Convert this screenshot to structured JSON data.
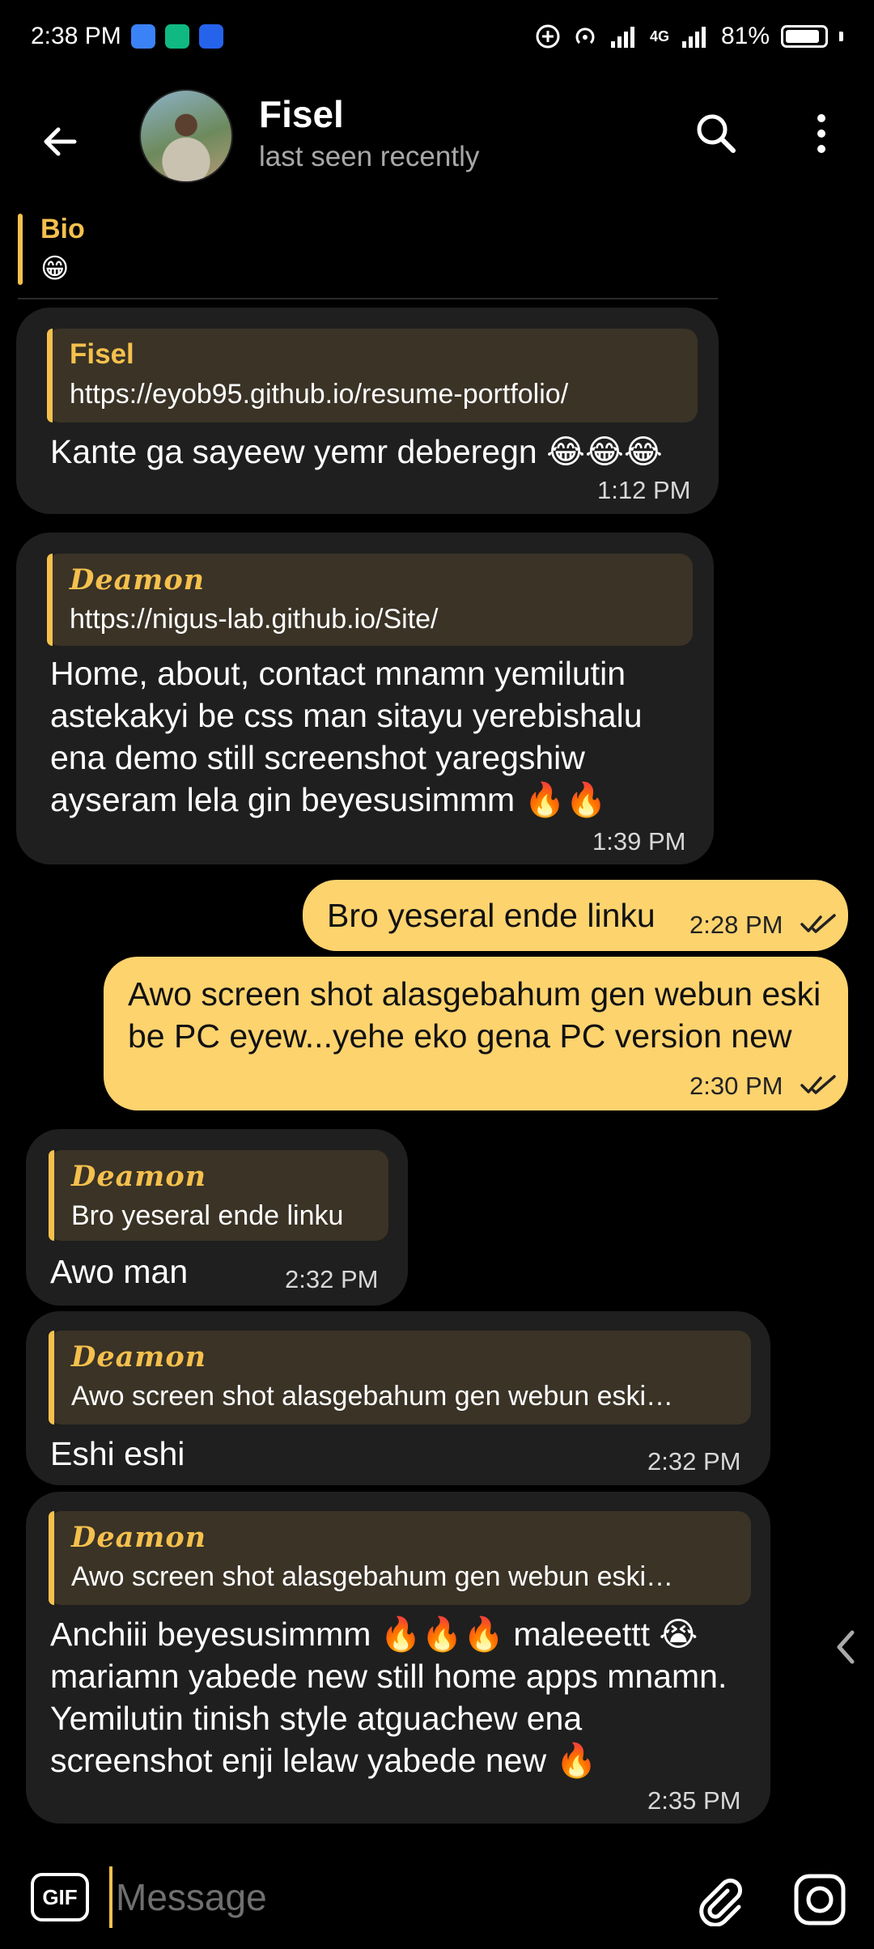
{
  "status_bar": {
    "time": "2:38 PM",
    "network": "4G",
    "battery": "81%",
    "app_icon_colors": [
      "#3b82f6",
      "#10b981",
      "#2563eb"
    ]
  },
  "header": {
    "contact_name": "Fisel",
    "status": "last seen recently",
    "icons": [
      "back-arrow-icon",
      "search-icon",
      "more-vert-icon"
    ]
  },
  "bio": {
    "label": "Bio",
    "emoji": "😁"
  },
  "messages": [
    {
      "direction": "in",
      "reply_name": "Fisel",
      "reply_text": "https://eyob95.github.io/resume-portfolio/",
      "text": "Kante ga sayeew yemr deberegn 😂😂😂",
      "time": "1:12 PM"
    },
    {
      "direction": "in",
      "reply_name": "Deamon",
      "reply_text": "https://nigus-lab.github.io/Site/",
      "text": "Home, about, contact mnamn yemilutin astekakyi be css man sitayu yerebishalu ena demo still screenshot yaregshiw ayseram lela gin beyesusimmm 🔥🔥",
      "time": "1:39 PM"
    },
    {
      "direction": "out",
      "text": "Bro yeseral ende linku",
      "time": "2:28 PM",
      "read": true
    },
    {
      "direction": "out",
      "text": "Awo screen shot alasgebahum gen webun eski be PC eyew...yehe eko gena PC version new",
      "time": "2:30 PM",
      "read": true
    },
    {
      "direction": "in",
      "reply_name": "Deamon",
      "reply_text": "Bro yeseral ende linku",
      "text": "Awo man",
      "time": "2:32 PM"
    },
    {
      "direction": "in",
      "reply_name": "Deamon",
      "reply_text": "Awo screen shot alasgebahum gen webun eski…",
      "text": "Eshi eshi",
      "time": "2:32 PM"
    },
    {
      "direction": "in",
      "reply_name": "Deamon",
      "reply_text": "Awo screen shot alasgebahum gen webun eski…",
      "text": "Anchiii beyesusimmm 🔥🔥🔥 maleeettt 😭 mariamn yabede new still home apps mnamn. Yemilutin tinish style atguachew ena screenshot enji lelaw yabede new 🔥",
      "time": "2:35 PM"
    }
  ],
  "input": {
    "gif_label": "GIF",
    "placeholder": "Message"
  },
  "colors": {
    "accent": "#f5c04d",
    "outgoing_bubble": "#fdd36e",
    "incoming_bubble": "#1f1f1f",
    "reply_background": "#3a3326"
  }
}
